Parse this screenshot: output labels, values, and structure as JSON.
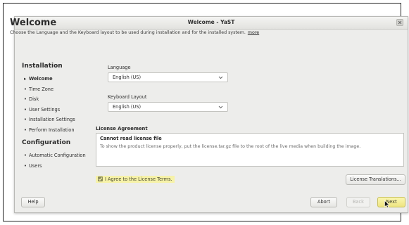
{
  "window": {
    "title": "Welcome - YaST"
  },
  "header": {
    "title": "Welcome",
    "subtitle": "Choose the Language and the Keyboard layout to be used during installation and for the installed system.",
    "more_link": "more"
  },
  "sidebar": {
    "installation_heading": "Installation",
    "installation_items": [
      {
        "label": "Welcome",
        "active": true
      },
      {
        "label": "Time Zone"
      },
      {
        "label": "Disk"
      },
      {
        "label": "User Settings"
      },
      {
        "label": "Installation Settings"
      },
      {
        "label": "Perform Installation"
      }
    ],
    "configuration_heading": "Configuration",
    "configuration_items": [
      {
        "label": "Automatic Configuration"
      },
      {
        "label": "Users"
      }
    ]
  },
  "form": {
    "language_label": "Language",
    "language_value": "English (US)",
    "keyboard_label": "Keyboard Layout",
    "keyboard_value": "English (US)"
  },
  "license": {
    "heading": "License Agreement",
    "error_title": "Cannot read license file",
    "error_body": "To show the product license properly, put the license.tar.gz file to the root of the live media when building the image.",
    "agree_label": "I Agree to the License Terms.",
    "agree_checked": true,
    "translations_button": "License Translations..."
  },
  "footer": {
    "help": "Help",
    "abort": "Abort",
    "back": "Back",
    "next": "Next"
  },
  "colors": {
    "agree_highlight": "#f6f2a8",
    "next_button": "#ede480"
  }
}
